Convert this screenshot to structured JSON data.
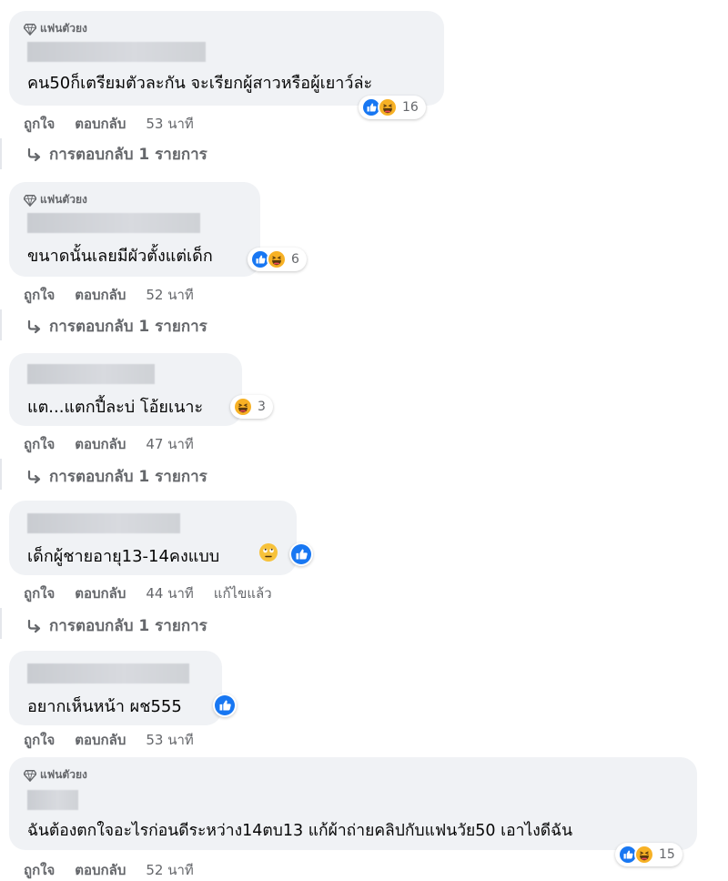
{
  "badge_label": "แฟนตัวยง",
  "action_like": "ถูกใจ",
  "action_reply": "ตอบกลับ",
  "comments": [
    {
      "text": "คน50ก็เตรียมตัวละกัน จะเรียกผู้สาวหรือผู้เยาว์ล่ะ",
      "time": "53 นาที",
      "reaction_count": "16",
      "replies": "การตอบกลับ 1 รายการ"
    },
    {
      "text": "ขนาดนั้นเลยมีผัวตั้งแต่เด็ก",
      "time": "52 นาที",
      "reaction_count": "6",
      "replies": "การตอบกลับ 1 รายการ"
    },
    {
      "text": "แต...แตกปี้ละบ่ โอ้ยเนาะ",
      "time": "47 นาที",
      "reaction_count": "3",
      "replies": "การตอบกลับ 1 รายการ"
    },
    {
      "text": "เด็กผู้ชายอายุ13-14คงแบบ",
      "time": "44 นาที",
      "edited": "แก้ไขแล้ว",
      "replies": "การตอบกลับ 1 รายการ"
    },
    {
      "text": "อยากเห็นหน้า ผช555",
      "time": "53 นาที"
    },
    {
      "text": "ฉันต้องตกใจอะไรก่อนดีระหว่าง14ตบ13 แก้ผ้าถ่ายคลิปกับแฟนวัย50 เอาไงดีฉัน",
      "time": "52 นาที",
      "reaction_count": "15"
    }
  ],
  "colors": {
    "bubble": "#f0f2f5",
    "like_blue": "#1877f2",
    "haha_yellow": "#f7b125",
    "meta_gray": "#65676b"
  }
}
